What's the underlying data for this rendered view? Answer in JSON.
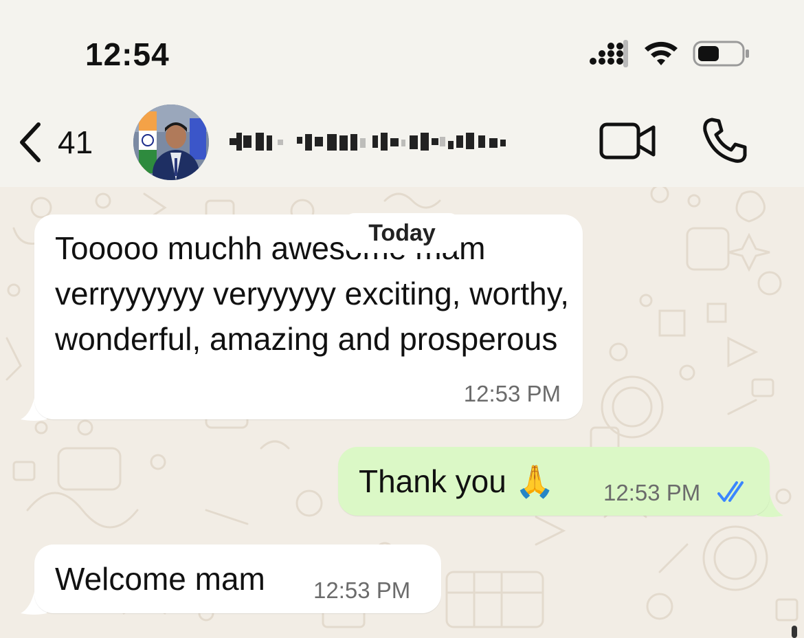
{
  "status_bar": {
    "time": "12:54"
  },
  "header": {
    "back_count": "41",
    "contact_name": "",
    "icons": {
      "back": "chevron-left-icon",
      "video": "video-call-icon",
      "call": "phone-icon"
    }
  },
  "chat": {
    "date_divider": "Today",
    "messages": [
      {
        "direction": "incoming",
        "text": "Tooooo muchh awesome mam verryyyyyy veryyyyy exciting, worthy, wonderful, amazing and prosperous",
        "time": "12:53 PM"
      },
      {
        "direction": "outgoing",
        "text": "Thank you",
        "emoji": "🙏",
        "time": "12:53 PM",
        "status": "read"
      },
      {
        "direction": "incoming",
        "text": "Welcome mam",
        "time": "12:53 PM"
      }
    ]
  },
  "colors": {
    "incoming_bubble": "#ffffff",
    "outgoing_bubble": "#dbf8c6",
    "read_ticks": "#3a86ff",
    "chat_background": "#f2ede5"
  }
}
